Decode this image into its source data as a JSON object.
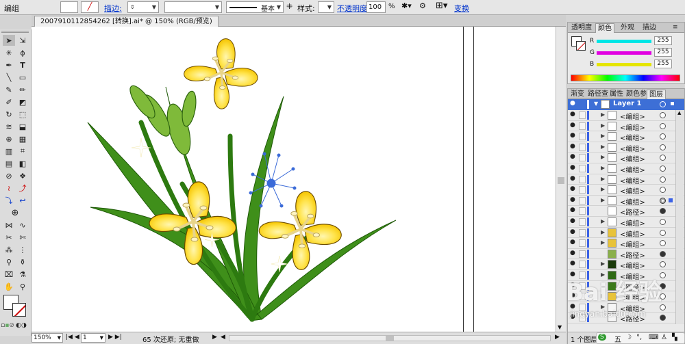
{
  "control_bar": {
    "mode": "编组",
    "stroke_label": "描边:",
    "line_style": "基本",
    "style_label": "样式:",
    "opacity_label": "不透明度:",
    "opacity_value": "100",
    "percent": "%",
    "transform_label": "变换"
  },
  "document": {
    "tab_title": "2007910112854262 [转换].ai* @ 150% (RGB/预览)"
  },
  "status_bar": {
    "zoom": "150%",
    "artboard": "1",
    "history": "65 次还原; 无重做"
  },
  "color_panel": {
    "tabs": [
      "透明度",
      "颜色",
      "外观",
      "描边"
    ],
    "active_tab": "颜色",
    "channels": [
      {
        "label": "R",
        "value": "255",
        "color": "#00e5e5"
      },
      {
        "label": "G",
        "value": "255",
        "color": "#e100e1"
      },
      {
        "label": "B",
        "value": "255",
        "color": "#e5e500"
      }
    ]
  },
  "layers_panel": {
    "tabs": [
      "渐变",
      "路径查",
      "属性",
      "颜色参",
      "图层"
    ],
    "active_tab": "图层",
    "layer_name": "Layer 1",
    "rows": [
      {
        "name": "<编组>",
        "type": "group",
        "target": "empty"
      },
      {
        "name": "<编组>",
        "type": "group",
        "target": "empty"
      },
      {
        "name": "<编组>",
        "type": "group",
        "target": "empty"
      },
      {
        "name": "<编组>",
        "type": "group",
        "target": "empty"
      },
      {
        "name": "<编组>",
        "type": "group",
        "target": "empty"
      },
      {
        "name": "<编组>",
        "type": "group",
        "target": "empty"
      },
      {
        "name": "<编组>",
        "type": "group",
        "target": "empty"
      },
      {
        "name": "<编组>",
        "type": "group",
        "target": "empty"
      },
      {
        "name": "<编组>",
        "type": "group",
        "target": "selected"
      },
      {
        "name": "<路径>",
        "type": "path",
        "target": "filled"
      },
      {
        "name": "<编组>",
        "type": "group",
        "target": "empty"
      },
      {
        "name": "<编组>",
        "type": "group",
        "target": "empty"
      },
      {
        "name": "<编组>",
        "type": "group",
        "target": "empty"
      },
      {
        "name": "<路径>",
        "type": "path",
        "target": "filled"
      },
      {
        "name": "<编组>",
        "type": "group",
        "target": "empty"
      },
      {
        "name": "<编组>",
        "type": "group",
        "target": "empty"
      },
      {
        "name": "<路径>",
        "type": "path",
        "target": "filled"
      },
      {
        "name": "<编组>",
        "type": "group",
        "target": "empty"
      },
      {
        "name": "<编组>",
        "type": "group",
        "target": "empty"
      },
      {
        "name": "<路径>",
        "type": "path",
        "target": "filled"
      }
    ],
    "footer": "1 个图层"
  },
  "watermark": {
    "text": "Bai 经验",
    "url": "jingyan.baidu.com"
  },
  "tray_text": "五"
}
